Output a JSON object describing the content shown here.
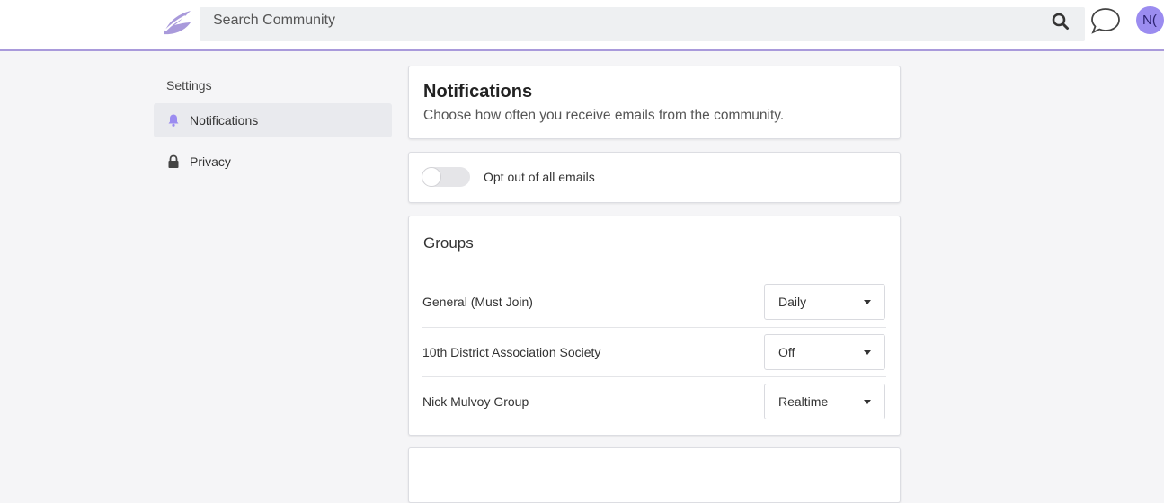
{
  "header": {
    "search_placeholder": "Search Community",
    "avatar_initials": "N(",
    "accent_color": "#a99adb",
    "avatar_color": "#9b8cf0"
  },
  "sidebar": {
    "heading": "Settings",
    "items": [
      {
        "label": "Notifications",
        "icon": "bell-icon",
        "active": true
      },
      {
        "label": "Privacy",
        "icon": "lock-icon",
        "active": false
      }
    ]
  },
  "notifications": {
    "title": "Notifications",
    "subtitle": "Choose how often you receive emails from the community."
  },
  "opt_out": {
    "label": "Opt out of all emails",
    "enabled": false
  },
  "groups": {
    "title": "Groups",
    "rows": [
      {
        "name": "General (Must Join)",
        "frequency": "Daily"
      },
      {
        "name": "10th District Association Society",
        "frequency": "Off"
      },
      {
        "name": "Nick Mulvoy Group",
        "frequency": "Realtime"
      }
    ]
  },
  "next_section": {
    "title": ""
  }
}
